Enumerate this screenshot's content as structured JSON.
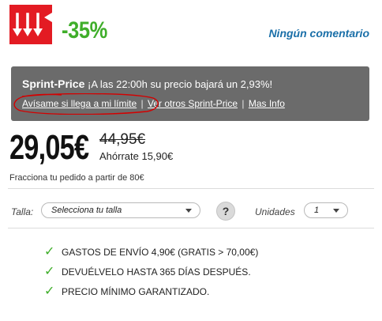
{
  "header": {
    "badge_icon": "falling-arrows-price-drop-icon",
    "discount": "-35%",
    "comments_link": "Ningún comentario"
  },
  "sprint": {
    "title": "Sprint-Price",
    "message": "¡A las 22:00h su precio bajará un 2,93%!",
    "links": {
      "notify": "Avísame si llega a mi límite",
      "others": "Ver otros Sprint-Price",
      "more_info": "Mas Info"
    },
    "separator": "|"
  },
  "pricing": {
    "price": "29,05€",
    "old_price": "44,95€",
    "savings": "Ahórrate 15,90€",
    "installments": "Fracciona tu pedido a partir de 80€"
  },
  "options": {
    "size_label": "Talla:",
    "size_value": "Selecciona tu talla",
    "help_symbol": "?",
    "units_label": "Unidades",
    "units_value": "1"
  },
  "benefits": [
    {
      "text": "GASTOS DE ENVÍO 4,90€ (GRATIS > 70,00€)"
    },
    {
      "text": "DEVUÉLVELO HASTA 365 DÍAS DESPUÉS."
    },
    {
      "text": "PRECIO MÍNIMO GARANTIZADO."
    }
  ],
  "colors": {
    "accent_red": "#e31b23",
    "discount_green": "#3fae2a",
    "link_blue": "#1a6fa8",
    "panel_gray": "#6b6b6b",
    "annotation_red": "#d40000"
  }
}
